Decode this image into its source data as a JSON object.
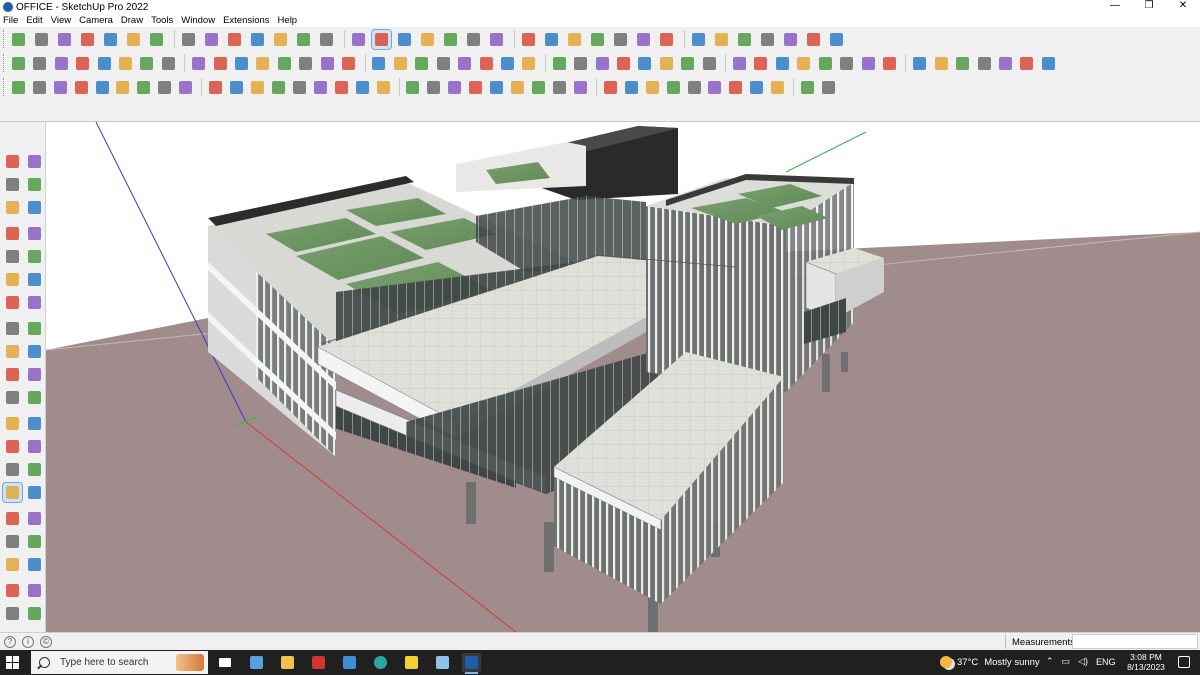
{
  "window": {
    "title": "OFFICE - SketchUp Pro 2022",
    "controls": {
      "minimize": "—",
      "maximize": "❐",
      "close": "✕"
    }
  },
  "menu": [
    "File",
    "Edit",
    "View",
    "Camera",
    "Draw",
    "Tools",
    "Window",
    "Extensions",
    "Help"
  ],
  "toolbars": {
    "row1_count": 35,
    "row2_count": 47,
    "row3_count": 38,
    "row1_active_tool": "orbit-tool",
    "accent_colors": [
      "#d84a3a",
      "#2f7dc4",
      "#e2a73a",
      "#4d9a44",
      "#6b6b6b",
      "#8a5cc2"
    ]
  },
  "left_toolbar": {
    "active_tool": "orbit-tool",
    "tools": [
      "select-icon",
      "orbit-cursor-icon",
      "paint-bucket-icon",
      "eraser-icon",
      "component-icon",
      "tag-icon",
      "line-icon",
      "freehand-icon",
      "rectangle-icon",
      "rotated-rectangle-icon",
      "circle-icon",
      "polygon-icon",
      "arc-icon",
      "two-point-arc-icon",
      "three-point-arc-icon",
      "pie-icon",
      "move-icon",
      "push-pull-icon",
      "rotate-icon",
      "follow-me-icon",
      "scale-icon",
      "offset-icon",
      "tape-measure-icon",
      "dimension-icon",
      "protractor-icon",
      "text-icon",
      "axes-icon",
      "3d-text-icon",
      "orbit-icon",
      "pan-icon",
      "zoom-icon",
      "zoom-window-icon",
      "zoom-extents-icon",
      "previous-view-icon",
      "position-camera-icon",
      "look-around-icon",
      "walk-icon",
      "section-plane-icon",
      "warehouse-icon",
      "extension-icon"
    ]
  },
  "viewport": {
    "background": "#ffffff",
    "ground_color": "#a08c8c",
    "axis_colors": {
      "red": "#d43b3b",
      "green": "#3bb24a",
      "blue": "#3b3bd4"
    }
  },
  "statusbar": {
    "icons": [
      "?",
      "i",
      "©"
    ],
    "measurements_label": "Measurements",
    "measurements_value": ""
  },
  "taskbar": {
    "search_placeholder": "Type here to search",
    "apps": [
      "task-view",
      "calculator",
      "file-explorer",
      "acrobat",
      "store",
      "edge",
      "sticky-notes",
      "notepad",
      "sketchup"
    ],
    "weather": {
      "temp": "37°C",
      "condition": "Mostly sunny"
    },
    "language": "ENG",
    "time": "3:08 PM",
    "date": "8/13/2023"
  }
}
